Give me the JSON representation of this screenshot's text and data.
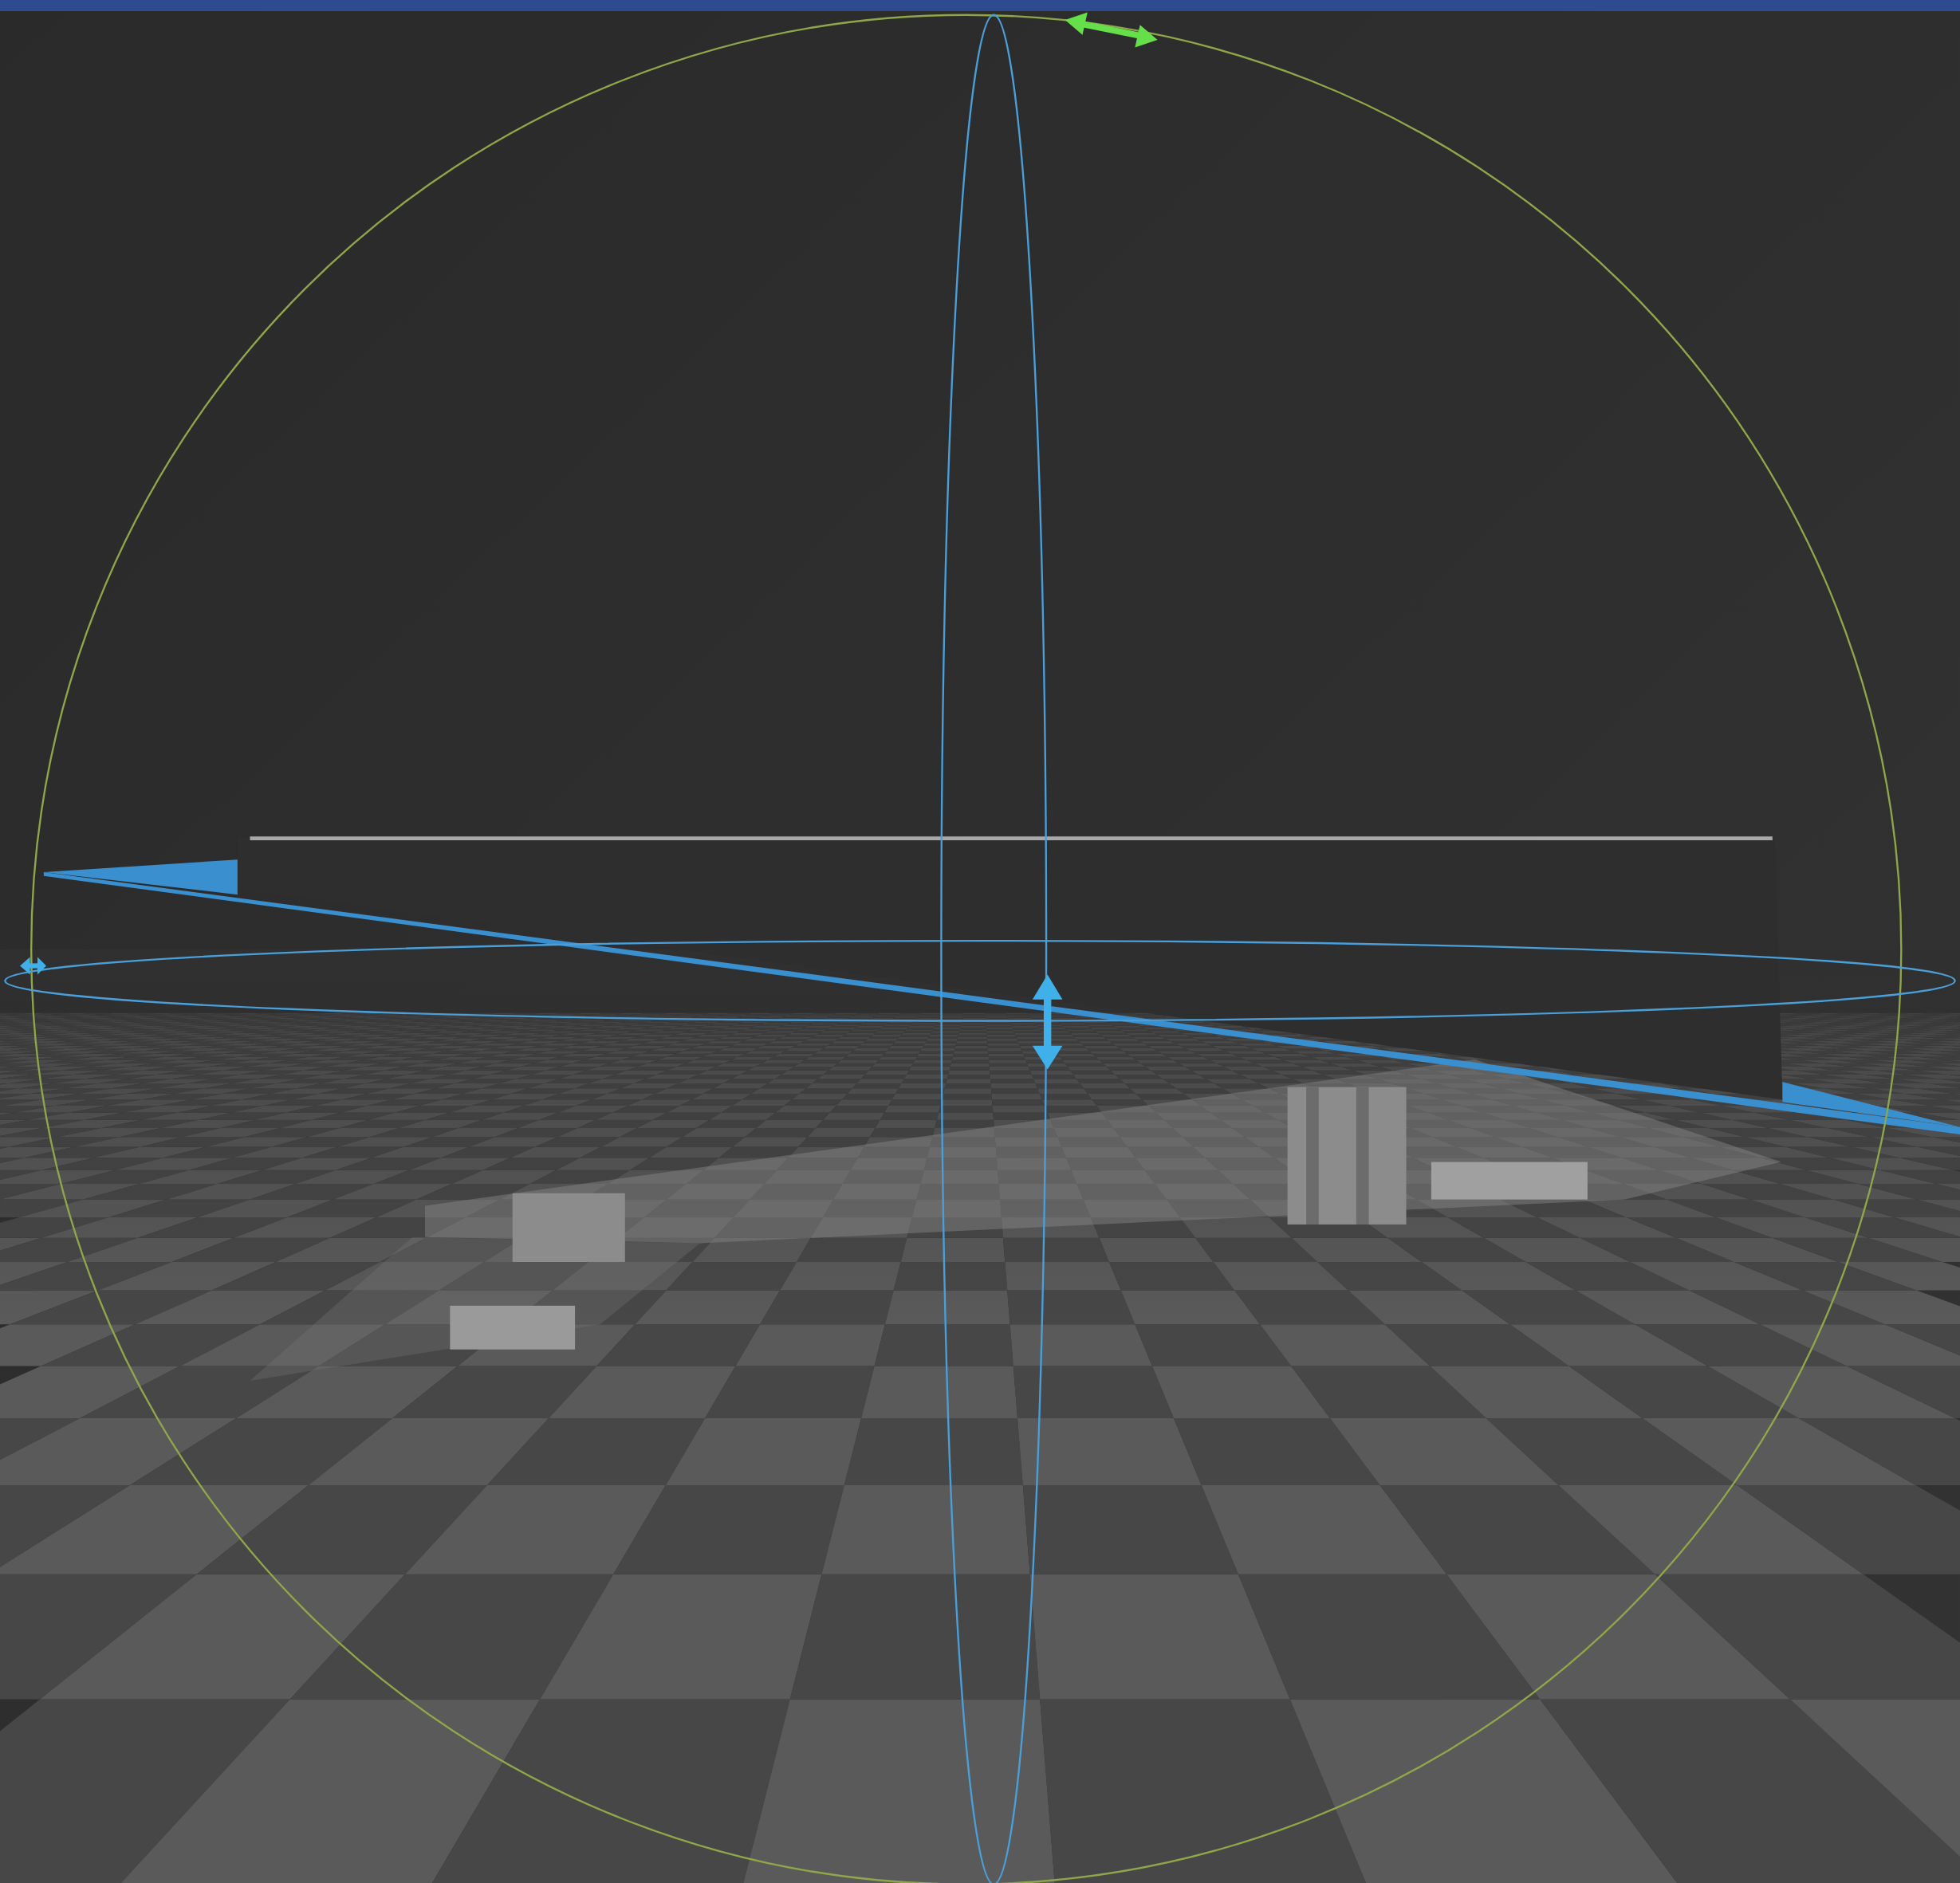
{
  "viewport": {
    "rotation_gizmo_shown": true
  }
}
